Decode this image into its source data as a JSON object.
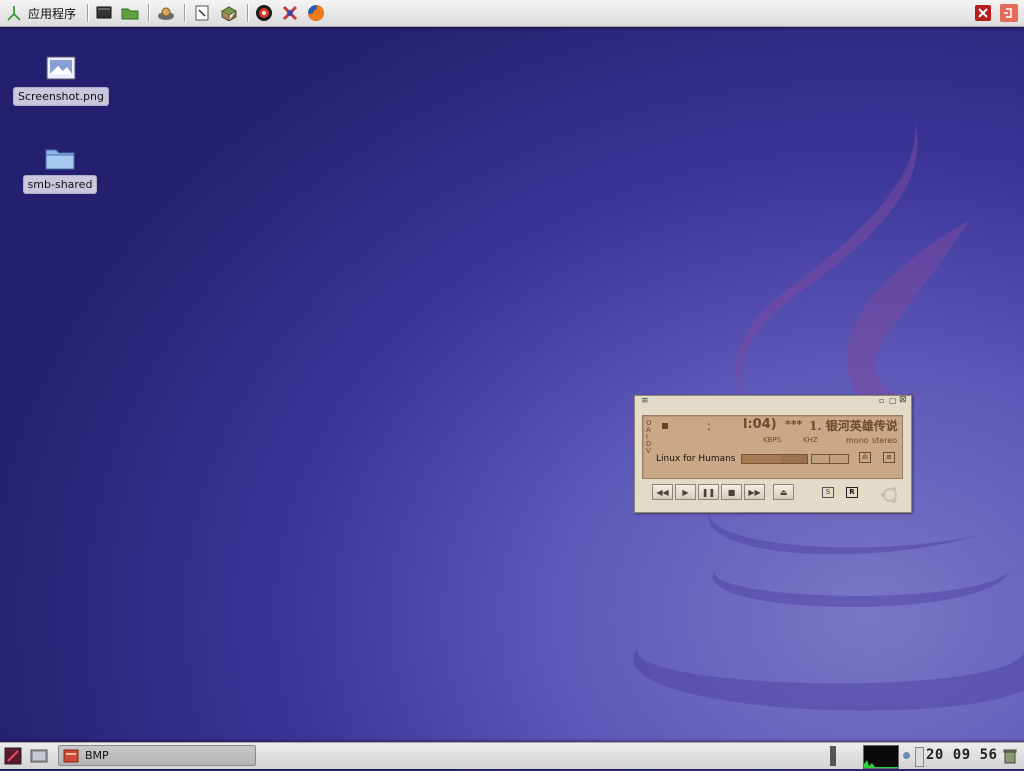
{
  "top_panel": {
    "apps_label": "应用程序",
    "launchers": [
      "terminal-icon",
      "file-manager-icon",
      "package-manager-icon",
      "text-editor-icon",
      "books-icon",
      "media-player-icon",
      "tools-icon",
      "firefox-icon"
    ],
    "right_icons": [
      "close-session-icon",
      "logout-icon"
    ]
  },
  "desktop": {
    "icons": [
      {
        "label": "Screenshot.png",
        "icon": "image-file-icon"
      },
      {
        "label": "smb-shared",
        "icon": "folder-icon"
      }
    ]
  },
  "player": {
    "time": "l:04)",
    "stars": "***",
    "track_title": "1. 银河英雄传说",
    "kbps_label": "KBPS",
    "khz_label": "KHZ",
    "mono_label": "mono",
    "stereo_label": "stereo",
    "vis_label": "O A I D V",
    "song_text": "Linux for Humans",
    "progress": 0.62,
    "repeat_label": "R",
    "shuffle_label": "S",
    "accent": "#c9a888"
  },
  "bottom_panel": {
    "task_label": "BMP",
    "clock": "20 09 56"
  }
}
